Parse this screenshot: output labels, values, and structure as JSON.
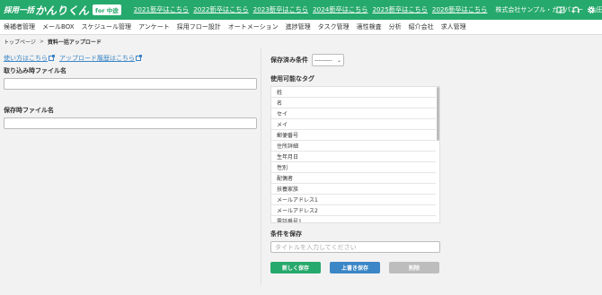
{
  "header": {
    "logo_text_1": "採用一括",
    "logo_text_2": "かんりくん",
    "logo_badge": "for 中途",
    "year_links": [
      "2021新卒はこちら",
      "2022新卒はこちら",
      "2023新卒はこちら",
      "2024新卒はこちら",
      "2025新卒はこちら",
      "2026新卒はこちら"
    ],
    "company": "株式会社サンプル・カンパニー",
    "user": "山田…",
    "icons": [
      "book-icon",
      "headset-icon",
      "gear-icon"
    ]
  },
  "nav": {
    "items": [
      "候補者管理",
      "メールBOX",
      "スケジュール管理",
      "アンケート",
      "採用フロー設計",
      "オートメーション",
      "進捗管理",
      "タスク管理",
      "適性検査",
      "分析",
      "紹介会社",
      "求人管理"
    ]
  },
  "breadcrumb": {
    "home": "トップページ",
    "separator": ">",
    "current": "資料一括アップロード"
  },
  "left": {
    "help_link": "使い方はこちら",
    "history_link": "アップロード履歴はこちら",
    "import_file_label": "取り込み時ファイル名",
    "import_file_value": "",
    "save_file_label": "保存時ファイル名",
    "save_file_value": ""
  },
  "right": {
    "saved_conditions_label": "保存済み条件",
    "saved_conditions_value": "---------",
    "tags_title": "使用可能なタグ",
    "tags": [
      "姓",
      "名",
      "セイ",
      "メイ",
      "郵便番号",
      "住所詳細",
      "生年月日",
      "性別",
      "配偶者",
      "扶養家族",
      "メールアドレス1",
      "メールアドレス2",
      "電話番号1"
    ],
    "save_condition_title": "条件を保存",
    "title_placeholder": "タイトルを入力してください",
    "buttons": {
      "new_save": "新しく保存",
      "overwrite": "上書き保存",
      "delete": "削除"
    }
  },
  "colors": {
    "brand_green": "#26a96c",
    "link_blue": "#3b86c6",
    "disabled_gray": "#bdbdbd"
  }
}
